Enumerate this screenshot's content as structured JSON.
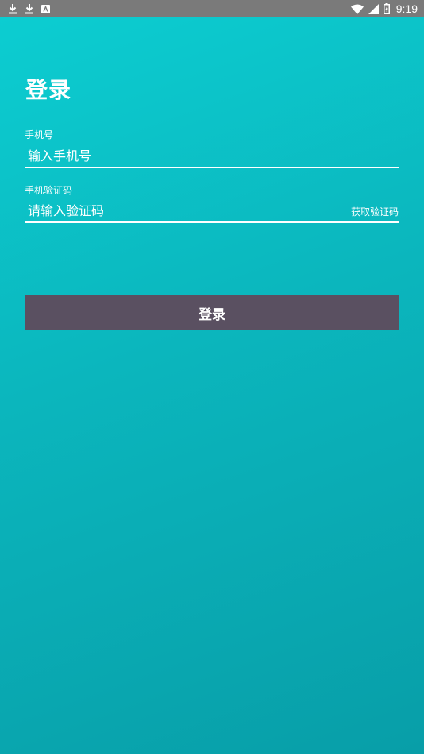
{
  "status_bar": {
    "time": "9:19",
    "left_icons": [
      "download-icon",
      "download-icon",
      "app-notification-icon"
    ],
    "right_icons": [
      "wifi-icon",
      "signal-icon",
      "battery-icon"
    ]
  },
  "page": {
    "title": "登录"
  },
  "phone_field": {
    "label": "手机号",
    "placeholder": "输入手机号"
  },
  "code_field": {
    "label": "手机验证码",
    "placeholder": "请输入验证码",
    "get_code_label": "获取验证码"
  },
  "login_button": {
    "label": "登录"
  },
  "colors": {
    "background_top": "#0cced2",
    "background_bottom": "#089ea8",
    "button": "#5a5061",
    "status_bar": "#7a7a7a"
  }
}
